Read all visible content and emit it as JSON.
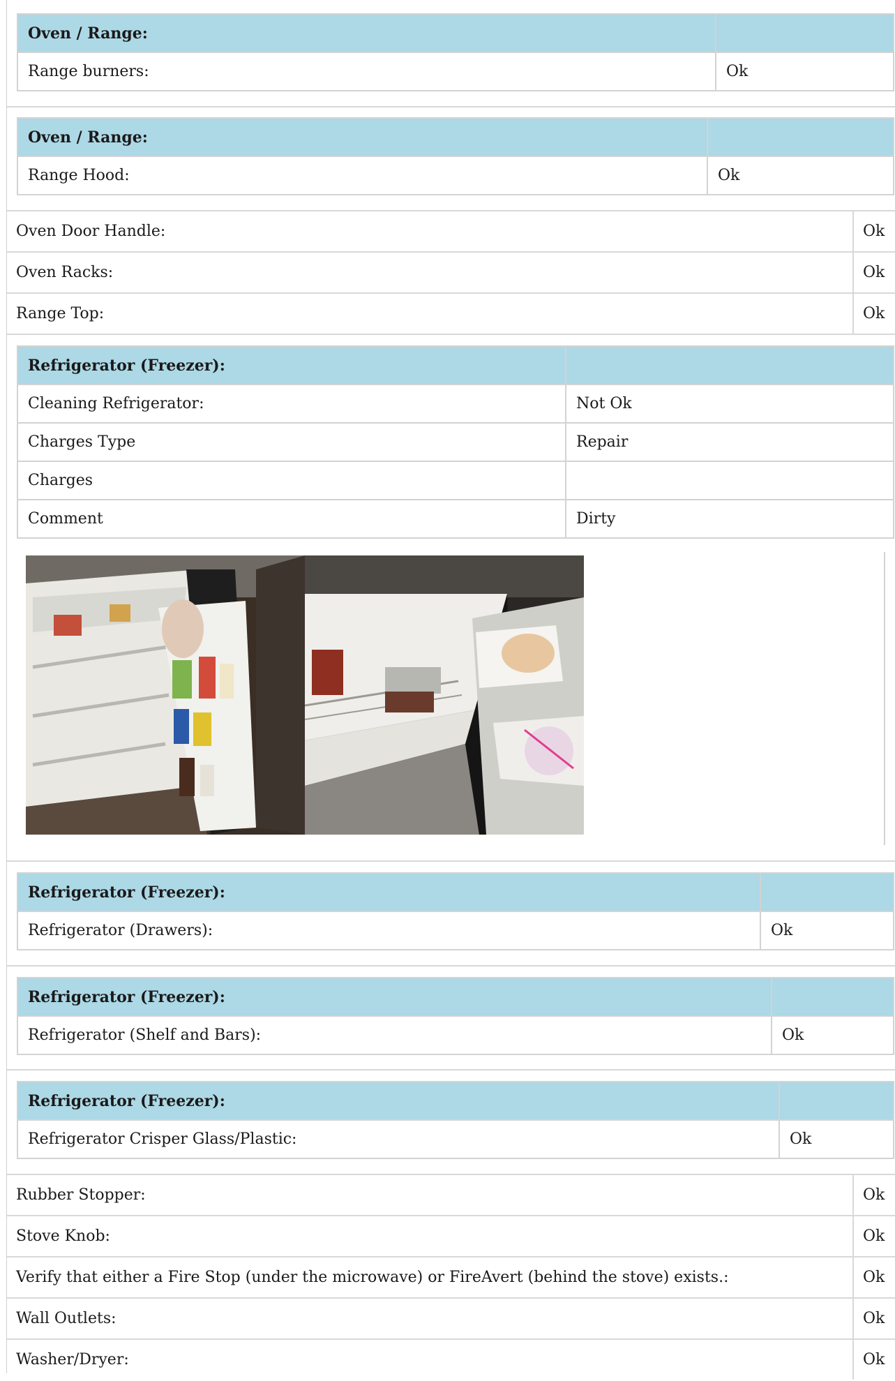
{
  "group1": {
    "header": "Oven / Range:",
    "label": "Range burners:",
    "value": "Ok"
  },
  "group2": {
    "header": "Oven / Range:",
    "label": "Range Hood:",
    "value": "Ok"
  },
  "rows_a": [
    {
      "label": "Oven Door Handle:",
      "value": "Ok"
    },
    {
      "label": "Oven Racks:",
      "value": "Ok"
    },
    {
      "label": "Range Top:",
      "value": "Ok"
    }
  ],
  "group3": {
    "header": "Refrigerator (Freezer):",
    "rows": [
      {
        "label": "Cleaning Refrigerator:",
        "value": "Not Ok"
      },
      {
        "label": "Charges Type",
        "value": "Repair"
      },
      {
        "label": "Charges",
        "value": ""
      },
      {
        "label": "Comment",
        "value": "Dirty"
      }
    ]
  },
  "group4": {
    "header": "Refrigerator (Freezer):",
    "label": "Refrigerator (Drawers):",
    "value": "Ok"
  },
  "group5": {
    "header": "Refrigerator (Freezer):",
    "label": "Refrigerator (Shelf and Bars):",
    "value": "Ok"
  },
  "group6": {
    "header": "Refrigerator (Freezer):",
    "label": "Refrigerator Crisper Glass/Plastic:",
    "value": "Ok"
  },
  "rows_b": [
    {
      "label": "Rubber Stopper:",
      "value": "Ok"
    },
    {
      "label": "Stove Knob:",
      "value": "Ok"
    },
    {
      "label": "Verify that either a Fire Stop (under the microwave) or FireAvert (behind the stove) exists.:",
      "value": "Ok"
    },
    {
      "label": "Wall Outlets:",
      "value": "Ok"
    },
    {
      "label": "Washer/Dryer:",
      "value": "Ok"
    }
  ],
  "colors": {
    "header_bg": "#add8e6",
    "border": "#d3d3d3"
  }
}
